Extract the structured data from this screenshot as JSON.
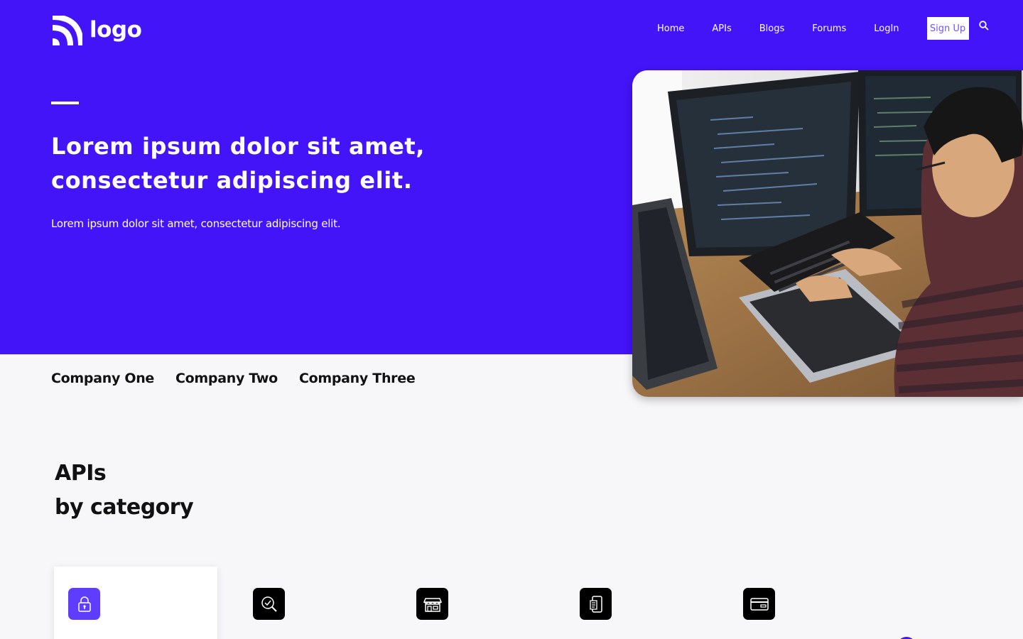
{
  "brand": {
    "logo_text": "logo",
    "primary_color": "#4314f7",
    "accent_color": "#5f3dff"
  },
  "nav": {
    "links": [
      "Home",
      "APIs",
      "Blogs",
      "Forums",
      "LogIn"
    ],
    "signup_label": "Sign Up",
    "search_icon": "search-icon"
  },
  "hero": {
    "title_line1": "Lorem ipsum dolor sit amet,",
    "title_line2": "consectetur adipiscing elit.",
    "subtitle": "Lorem ipsum dolor sit amet, consectetur adipiscing elit.",
    "image": "developer-at-computers-photo"
  },
  "companies": [
    "Company One",
    "Company Two",
    "Company Three"
  ],
  "section": {
    "title_line1": "APIs",
    "title_line2": "by category"
  },
  "categories": [
    {
      "icon": "lock-icon",
      "active": true
    },
    {
      "icon": "magnifier-check-icon",
      "active": false
    },
    {
      "icon": "storefront-icon",
      "active": false
    },
    {
      "icon": "mobile-document-icon",
      "active": false
    },
    {
      "icon": "credit-card-icon",
      "active": false
    }
  ]
}
